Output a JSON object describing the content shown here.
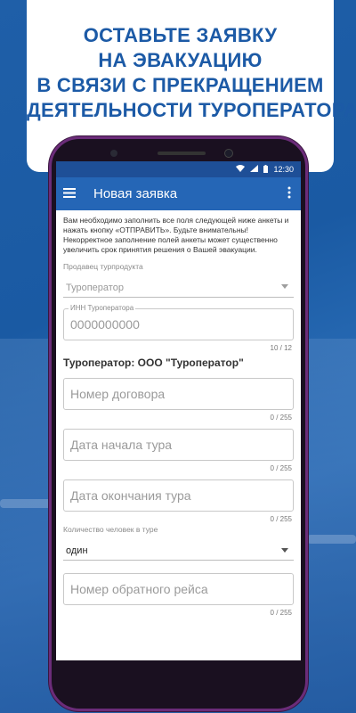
{
  "headline": {
    "lines": [
      "ОСТАВЬТЕ ЗАЯВКУ",
      "НА ЭВАКУАЦИЮ",
      "В СВЯЗИ С ПРЕКРАЩЕНИЕМ",
      "ДЕЯТЕЛЬНОСТИ ТУРОПЕРАТОРА"
    ],
    "color": "#1c5aa6"
  },
  "status_bar": {
    "time": "12:30"
  },
  "app_bar": {
    "title": "Новая заявка",
    "color": "#2566b6"
  },
  "form": {
    "notice": "Вам необходимо заполнить все поля следующей ниже анкеты и нажать кнопку «ОТПРАВИТЬ». Будьте внимательны! Некорректное заполнение полей анкеты может существенно увеличить срок принятия решения о Вашей эвакуации.",
    "seller_label": "Продавец турпродукта",
    "seller_value": "Туроператор",
    "inn_label": "ИНН Туроператора",
    "inn_value": "0000000000",
    "inn_counter": "10 / 12",
    "operator_text": "Туроператор: ООО \"Туроператор\"",
    "contract_placeholder": "Номер договора",
    "contract_counter": "0 / 255",
    "start_placeholder": "Дата начала тура",
    "start_counter": "0 / 255",
    "end_placeholder": "Дата окончания тура",
    "end_counter": "0 / 255",
    "people_label": "Количество человек в туре",
    "people_value": "один",
    "return_flight_placeholder": "Номер обратного рейса",
    "return_flight_counter": "0 / 255"
  }
}
